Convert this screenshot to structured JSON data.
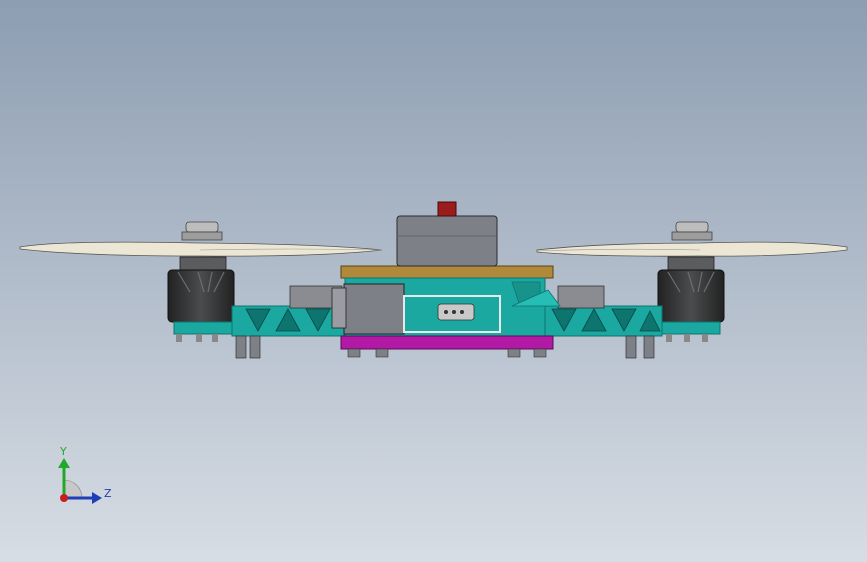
{
  "viewport": {
    "background_top": "#8d9db2",
    "background_bottom": "#d7dde4"
  },
  "model": {
    "colors": {
      "frame": "#1aa8a0",
      "frame_dark": "#0e7470",
      "motor": "#3b3d3f",
      "propeller": "#ece7d4",
      "top_plate": "#b08a3a",
      "bottom_plate": "#b21aa6",
      "component_gray": "#7e8088",
      "indicator_red": "#9a1c1c"
    },
    "parts": [
      "propeller",
      "motor",
      "arm",
      "top-plate",
      "bottom-plate",
      "battery-box",
      "indicator",
      "camera-box",
      "standoff"
    ]
  },
  "triad": {
    "y_label": "Y",
    "z_label": "Z",
    "y_color": "#21a82b",
    "z_color": "#1f3fb8",
    "origin_color": "#c81e1e"
  }
}
